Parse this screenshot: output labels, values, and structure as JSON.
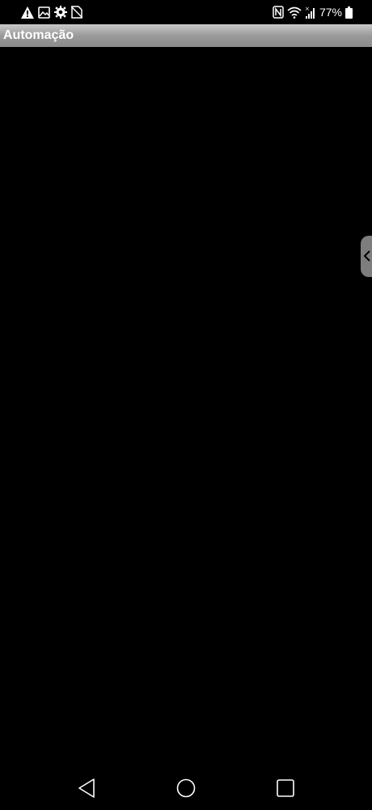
{
  "status_bar": {
    "left_icons": [
      "warning-icon",
      "image-icon",
      "settings-icon",
      "no-sim-icon"
    ],
    "right_icons": [
      "nfc-icon",
      "wifi-icon",
      "signal-icon",
      "battery-icon"
    ],
    "battery_percent": "77%"
  },
  "title_bar": {
    "title": "Automação"
  },
  "edge_panel": {
    "icon": "chevron-left-icon"
  },
  "nav_bar": {
    "buttons": [
      "back-icon",
      "home-icon",
      "recent-apps-icon"
    ]
  }
}
